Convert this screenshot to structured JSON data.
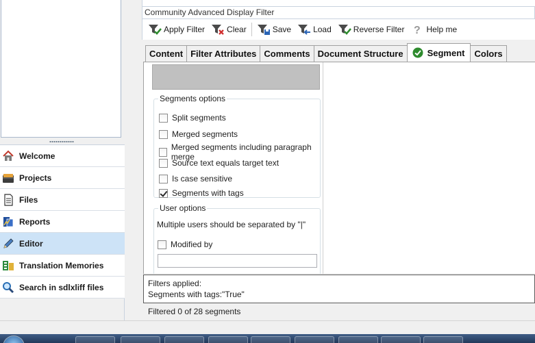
{
  "panel": {
    "title": "Community Advanced Display Filter"
  },
  "toolbar": {
    "apply_filter": "Apply Filter",
    "clear": "Clear",
    "save": "Save",
    "load": "Load",
    "reverse_filter": "Reverse Filter",
    "help_me": "Help me"
  },
  "tabs": [
    {
      "label": "Content"
    },
    {
      "label": "Filter Attributes"
    },
    {
      "label": "Comments"
    },
    {
      "label": "Document Structure"
    },
    {
      "label": "Segment",
      "active": true
    },
    {
      "label": "Colors"
    }
  ],
  "segments_options": {
    "legend": "Segments options",
    "items": [
      {
        "label": "Split segments",
        "checked": false
      },
      {
        "label": "Merged segments",
        "checked": false
      },
      {
        "label": "Merged segments including paragraph merge",
        "checked": false
      },
      {
        "label": "Source text equals target text",
        "checked": false
      },
      {
        "label": "Is case sensitive",
        "checked": false
      },
      {
        "label": "Segments with tags",
        "checked": true
      }
    ]
  },
  "user_options": {
    "legend": "User options",
    "note": "Multiple users should be separated by \"|\"",
    "modified_by": {
      "label": "Modified by",
      "checked": false
    },
    "modified_by_value": ""
  },
  "filters_applied": {
    "heading": "Filters applied:",
    "value": "Segments with tags:\"True\""
  },
  "status": {
    "text": "Filtered 0 of 28 segments"
  },
  "nav": {
    "items": [
      {
        "label": "Welcome",
        "icon": "home-icon"
      },
      {
        "label": "Projects",
        "icon": "projects-icon"
      },
      {
        "label": "Files",
        "icon": "files-icon"
      },
      {
        "label": "Reports",
        "icon": "reports-icon"
      },
      {
        "label": "Editor",
        "icon": "pencil-icon",
        "active": true
      },
      {
        "label": "Translation Memories",
        "icon": "translation-memories-icon"
      },
      {
        "label": "Search in sdlxliff files",
        "icon": "magnifier-icon"
      }
    ]
  },
  "colors": {
    "nav_active": "#cde3f7",
    "accent_green": "#2e8b2e",
    "taskbar": "#2f4a70"
  }
}
